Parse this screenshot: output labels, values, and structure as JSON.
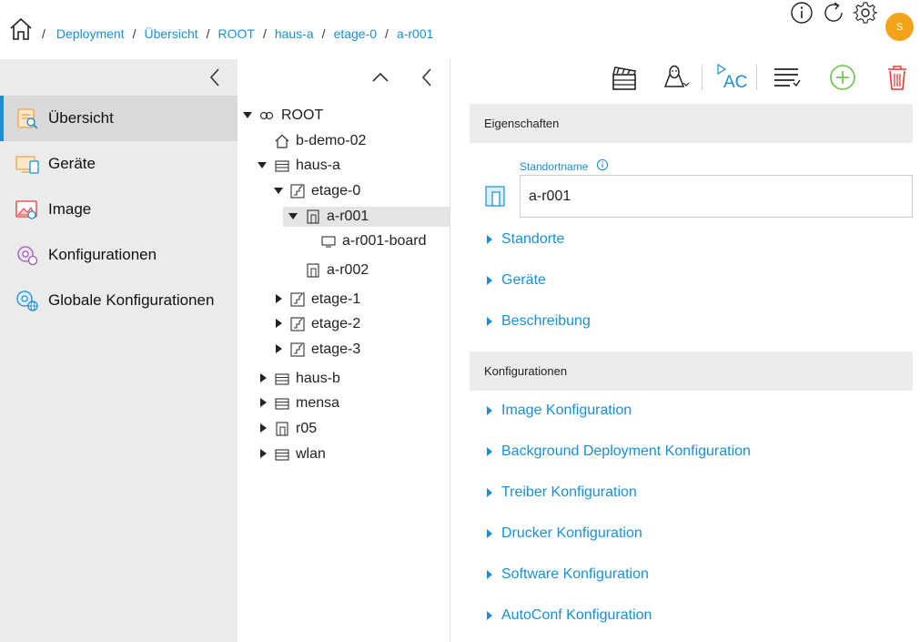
{
  "breadcrumb": {
    "items": [
      "Deployment",
      "Übersicht",
      "ROOT",
      "haus-a",
      "etage-0",
      "a-r001"
    ],
    "separator": "/"
  },
  "header": {
    "icons": [
      "info-icon",
      "refresh-icon",
      "settings-icon"
    ],
    "avatar_letter": "S",
    "avatar_color": "#f5a21b"
  },
  "nav": {
    "items": [
      {
        "label": "Übersicht",
        "icon": "overview-icon",
        "active": true
      },
      {
        "label": "Geräte",
        "icon": "devices-icon",
        "active": false
      },
      {
        "label": "Image",
        "icon": "image-icon",
        "active": false
      },
      {
        "label": "Konfigurationen",
        "icon": "configurations-icon",
        "active": false
      },
      {
        "label": "Globale Konfigurationen",
        "icon": "global-configurations-icon",
        "active": false
      }
    ]
  },
  "tree": {
    "nodes": [
      {
        "label": "ROOT",
        "icon": "root-icon",
        "expanded": true,
        "level": 0
      },
      {
        "label": "b-demo-02",
        "icon": "house-icon",
        "level": 1
      },
      {
        "label": "haus-a",
        "icon": "building-icon",
        "expanded": true,
        "level": 1
      },
      {
        "label": "etage-0",
        "icon": "floor-icon",
        "expanded": true,
        "level": 2
      },
      {
        "label": "a-r001",
        "icon": "room-icon",
        "expanded": true,
        "selected": true,
        "level": 3
      },
      {
        "label": "a-r001-board",
        "icon": "board-icon",
        "level": 4
      },
      {
        "label": "a-r002",
        "icon": "room-icon",
        "level": 3
      },
      {
        "label": "etage-1",
        "icon": "floor-icon",
        "expanded": false,
        "level": 2
      },
      {
        "label": "etage-2",
        "icon": "floor-icon",
        "expanded": false,
        "level": 2
      },
      {
        "label": "etage-3",
        "icon": "floor-icon",
        "expanded": false,
        "level": 2
      },
      {
        "label": "haus-b",
        "icon": "building-icon",
        "expanded": false,
        "level": 1
      },
      {
        "label": "mensa",
        "icon": "building-icon",
        "expanded": false,
        "level": 1
      },
      {
        "label": "r05",
        "icon": "room-icon",
        "expanded": false,
        "level": 1
      },
      {
        "label": "wlan",
        "icon": "building-icon",
        "expanded": false,
        "level": 1
      }
    ]
  },
  "toolbar": {
    "icons": [
      "clapperboard-icon",
      "linux-icon",
      "autoconf-icon",
      "list-icon",
      "add-icon",
      "delete-icon"
    ],
    "autoconf_text": "AC",
    "accent": "#1a8fd6",
    "add_color": "#6cc24a",
    "delete_color": "#e53935"
  },
  "properties": {
    "title": "Eigenschaften",
    "field_label": "Standortname",
    "field_value": "a-r001",
    "sections": [
      "Standorte",
      "Geräte",
      "Beschreibung"
    ]
  },
  "configurations": {
    "title": "Konfigurationen",
    "sections": [
      "Image Konfiguration",
      "Background Deployment Konfiguration",
      "Treiber Konfiguration",
      "Drucker Konfiguration",
      "Software Konfiguration",
      "AutoConf Konfiguration"
    ]
  }
}
